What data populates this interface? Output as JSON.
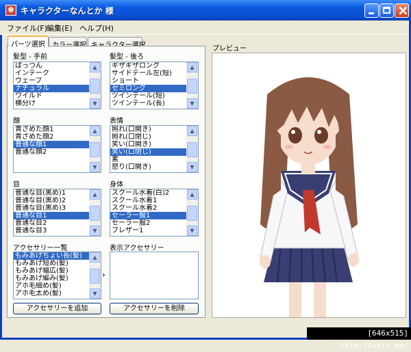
{
  "window": {
    "title": "キャラクターなんとか 様"
  },
  "menu": [
    "ファイル(F)",
    "編集(E)",
    "ヘルプ(H)"
  ],
  "tabs": [
    "パーツ選択",
    "カラー選択",
    "キャラクター選択"
  ],
  "sections": {
    "hair_front": {
      "label": "髪型 - 手前",
      "items": [
        "ぱっつん",
        "インテーク",
        "ウェーブ",
        "ナチュラル",
        "ワイルド",
        "横分け"
      ],
      "selected": 3
    },
    "hair_back": {
      "label": "髪型 - 後ろ",
      "items": [
        "ギザギザロング",
        "サイドテール左(短)",
        "ショート",
        "セミロング",
        "ツインテール(短)",
        "ツインテール(長)"
      ],
      "selected": 3
    },
    "face": {
      "label": "顔",
      "items": [
        "青ざめた顔1",
        "青ざめた顔2",
        "普通な顔1",
        "普通な顔2"
      ],
      "selected": 2
    },
    "expression": {
      "label": "表情",
      "items": [
        "照れ(口開き)",
        "照れ(口閉じ)",
        "笑い(口開き)",
        "笑い(口閉じ)",
        "素",
        "怒り(口開き)"
      ],
      "selected": 3
    },
    "eyes": {
      "label": "目",
      "items": [
        "普通な目(黒め)1",
        "普通な目(黒め)2",
        "普通な目(黒め)3",
        "普通な目1",
        "普通な目2",
        "普通な目3"
      ],
      "selected": 3
    },
    "body": {
      "label": "身体",
      "items": [
        "スクール水着(白)2",
        "スクール水着1",
        "スクール水着2",
        "セーラー服1",
        "セーラー服2",
        "ブレザー1"
      ],
      "selected": 3
    },
    "accessories": {
      "label": "アクセサリー一覧",
      "items": [
        "もみあげちょい長(髪)",
        "もみあげ短め(髪)",
        "もみあげ幅広(髪)",
        "もみあげ編み(髪)",
        "アホ毛細め(髪)",
        "アホ毛太め(髪)"
      ],
      "selected": 0
    },
    "shown_accessories": {
      "label": "表示アクセサリー",
      "items": []
    }
  },
  "buttons": {
    "add": "アクセサリーを追加",
    "remove": "アクセサリーを削除",
    "move": "›"
  },
  "preview": {
    "label": "プレビュー"
  },
  "status_bar": "[646x515] http://upic.me/",
  "colors": {
    "title_bar": "#0a5ae0",
    "selection": "#316ac5",
    "hair": "#8a5a44",
    "uniform_navy": "#3a3f73",
    "tie": "#c0392b"
  }
}
